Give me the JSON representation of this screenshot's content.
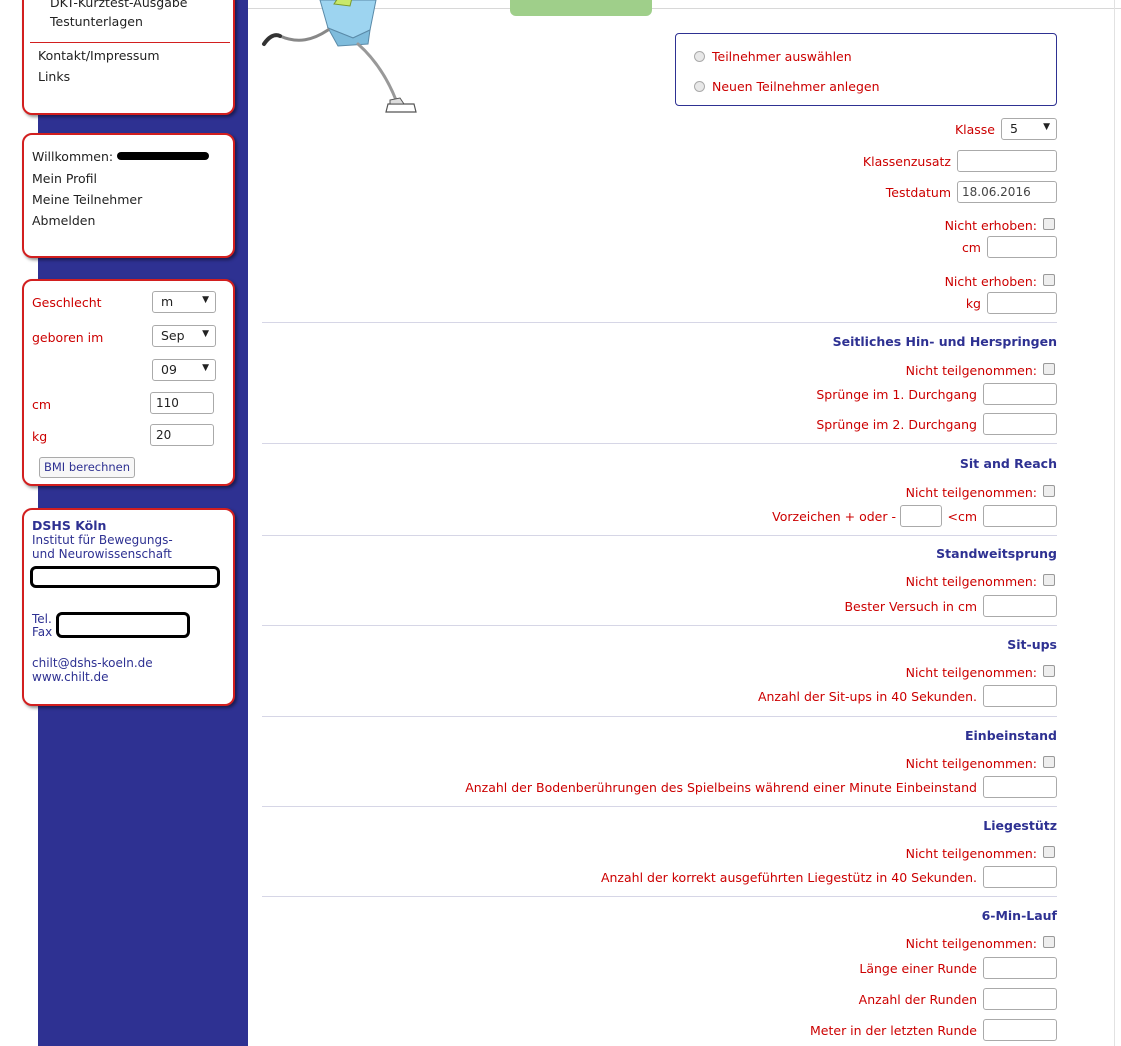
{
  "sidebar": {
    "nav": [
      "DKT-Kurztest-Ausgabe",
      "Testunterlagen",
      "Kontakt/Impressum",
      "Links"
    ],
    "user": {
      "welcome": "Willkommen:",
      "items": [
        "Mein Profil",
        "Meine Teilnehmer",
        "Abmelden"
      ]
    },
    "bmi": {
      "gender_label": "Geschlecht",
      "gender_value": "m",
      "born_label": "geboren im",
      "month_value": "Sep",
      "year_value": "09",
      "cm_label": "cm",
      "cm_value": "110",
      "kg_label": "kg",
      "kg_value": "20",
      "button": "BMI berechnen"
    },
    "contact": {
      "name": "DSHS Köln",
      "line1": "Institut für Bewegungs-",
      "line2": "und Neurowissenschaft",
      "tel": "Tel.",
      "fax": "Fax",
      "email": "chilt@dshs-koeln.de",
      "web": "www.chilt.de"
    }
  },
  "participant": {
    "select": "Teilnehmer auswählen",
    "create": "Neuen Teilnehmer anlegen"
  },
  "form": {
    "klasse_label": "Klasse",
    "klasse_value": "5",
    "klassenzusatz_label": "Klassenzusatz",
    "testdatum_label": "Testdatum",
    "testdatum_value": "18.06.2016",
    "not_collected": "Nicht erhoben:",
    "cm": "cm",
    "kg": "kg",
    "not_participated": "Nicht teilgenommen:"
  },
  "sections": {
    "s1": {
      "title": "Seitliches Hin- und Herspringen",
      "f1": "Sprünge im 1. Durchgang",
      "f2": "Sprünge im 2. Durchgang"
    },
    "s2": {
      "title": "Sit and Reach",
      "sign": "Vorzeichen + oder -",
      "cm": "<cm"
    },
    "s3": {
      "title": "Standweitsprung",
      "f1": "Bester Versuch in cm"
    },
    "s4": {
      "title": "Sit-ups",
      "f1": "Anzahl der Sit-ups in 40 Sekunden."
    },
    "s5": {
      "title": "Einbeinstand",
      "f1": "Anzahl der Bodenberührungen des Spielbeins während einer Minute Einbeinstand"
    },
    "s6": {
      "title": "Liegestütz",
      "f1": "Anzahl der korrekt ausgeführten Liegestütz in 40 Sekunden."
    },
    "s7": {
      "title": "6-Min-Lauf",
      "f1": "Länge einer Runde",
      "f2": "Anzahl der Runden",
      "f3": "Meter in der letzten Runde"
    }
  },
  "colors": {
    "accent": "#2e3192",
    "label_red": "#cc0000",
    "box_border": "#d21f1f"
  },
  "icons": [
    "runner-illustration",
    "radio-icon",
    "checkbox-icon",
    "dropdown-arrow-icon"
  ]
}
